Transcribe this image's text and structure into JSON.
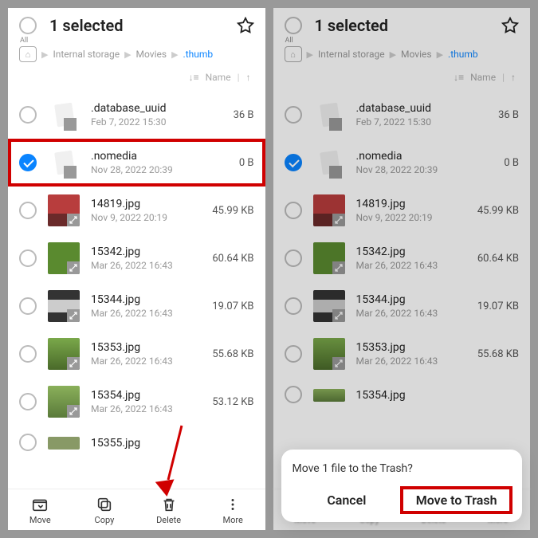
{
  "header": {
    "all_label": "All",
    "title": "1 selected"
  },
  "crumbs": {
    "c1": "Internal storage",
    "c2": "Movies",
    "c3": ".thumb"
  },
  "sort": {
    "label": "Name"
  },
  "files": [
    {
      "name": ".database_uuid",
      "meta": "Feb 7, 2022 15:30",
      "size": "36 B"
    },
    {
      "name": ".nomedia",
      "meta": "Nov 28, 2022 20:39",
      "size": "0 B"
    },
    {
      "name": "14819.jpg",
      "meta": "Nov 9, 2022 20:19",
      "size": "45.99 KB"
    },
    {
      "name": "15342.jpg",
      "meta": "Mar 26, 2022 16:43",
      "size": "60.64 KB"
    },
    {
      "name": "15344.jpg",
      "meta": "Mar 26, 2022 16:43",
      "size": "19.07 KB"
    },
    {
      "name": "15353.jpg",
      "meta": "Mar 26, 2022 16:43",
      "size": "55.68 KB"
    },
    {
      "name": "15354.jpg",
      "meta": "Mar 26, 2022 16:43",
      "size": "53.12 KB"
    },
    {
      "name": "15355.jpg",
      "meta": "",
      "size": ""
    }
  ],
  "bottombar": {
    "move": "Move",
    "copy": "Copy",
    "delete": "Delete",
    "more": "More"
  },
  "dialog": {
    "question": "Move 1 file to the Trash?",
    "cancel": "Cancel",
    "confirm": "Move to Trash"
  }
}
